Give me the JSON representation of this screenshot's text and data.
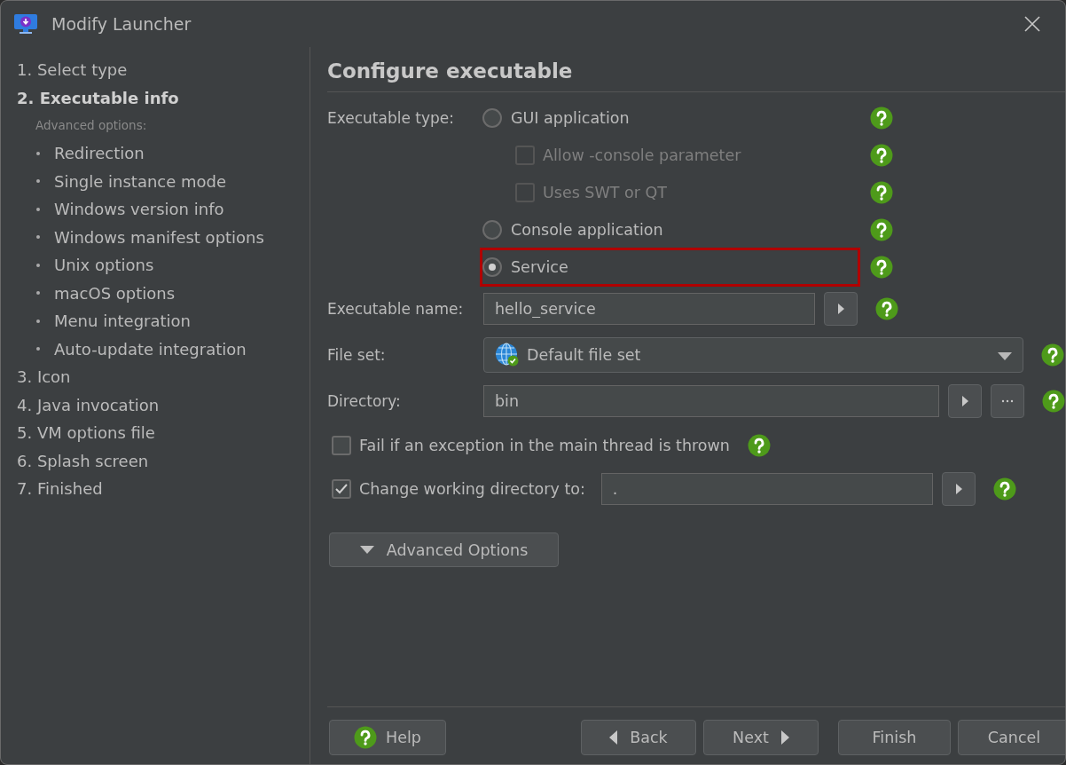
{
  "window": {
    "title": "Modify Launcher"
  },
  "sidebar": {
    "steps": [
      {
        "label": "1. Select type",
        "selected": false
      },
      {
        "label": "2. Executable info",
        "selected": true,
        "note": "Advanced options:",
        "children": [
          {
            "label": "Redirection"
          },
          {
            "label": "Single instance mode"
          },
          {
            "label": "Windows version info"
          },
          {
            "label": "Windows manifest options"
          },
          {
            "label": "Unix options"
          },
          {
            "label": "macOS options"
          },
          {
            "label": "Menu integration"
          },
          {
            "label": "Auto-update integration"
          }
        ]
      },
      {
        "label": "3. Icon",
        "selected": false
      },
      {
        "label": "4. Java invocation",
        "selected": false
      },
      {
        "label": "5. VM options file",
        "selected": false
      },
      {
        "label": "6. Splash screen",
        "selected": false
      },
      {
        "label": "7. Finished",
        "selected": false
      }
    ]
  },
  "heading": "Configure executable",
  "executable_type": {
    "label": "Executable type:",
    "options": [
      {
        "label": "GUI application",
        "selected": false,
        "highlighted": false,
        "children": [
          {
            "label": "Allow -console parameter",
            "checked": false,
            "disabled": true
          },
          {
            "label": "Uses SWT or QT",
            "checked": false,
            "disabled": true
          }
        ]
      },
      {
        "label": "Console application",
        "selected": false,
        "highlighted": false
      },
      {
        "label": "Service",
        "selected": true,
        "highlighted": true
      }
    ]
  },
  "executable_name": {
    "label": "Executable name:",
    "value": "hello_service"
  },
  "file_set": {
    "label": "File set:",
    "value": "Default file set"
  },
  "directory": {
    "label": "Directory:",
    "value": "bin"
  },
  "fail_on_exception": {
    "label": "Fail if an exception in the main thread is thrown",
    "checked": false
  },
  "working_directory": {
    "label": "Change working directory to:",
    "checked": true,
    "value": "."
  },
  "advanced_button": {
    "label": "Advanced Options"
  },
  "buttons": [
    {
      "kind": "help",
      "label": "Help"
    },
    {
      "kind": "back",
      "label": "Back"
    },
    {
      "kind": "next",
      "label": "Next"
    },
    {
      "kind": "plain",
      "label": "Finish"
    },
    {
      "kind": "plain",
      "label": "Cancel"
    }
  ]
}
